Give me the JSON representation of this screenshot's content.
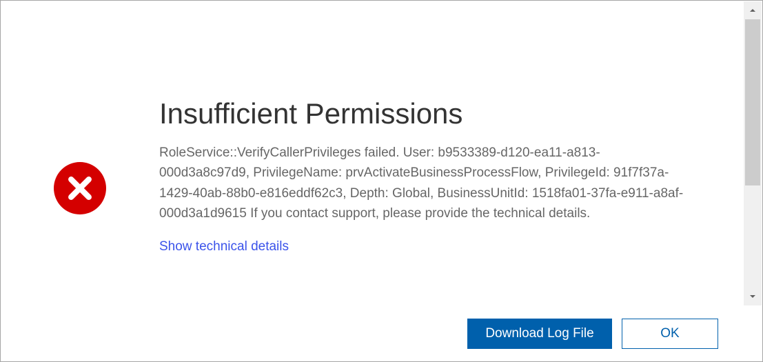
{
  "dialog": {
    "title": "Insufficient Permissions",
    "message": "RoleService::VerifyCallerPrivileges failed. User: b9533389-d120-ea11-a813-000d3a8c97d9, PrivilegeName: prvActivateBusinessProcessFlow, PrivilegeId: 91f7f37a-1429-40ab-88b0-e816eddf62c3, Depth: Global, BusinessUnitId: 1518fa01-37fa-e911-a8af-000d3a1d9615 If you contact support, please provide the technical details.",
    "technical_link": "Show technical details"
  },
  "buttons": {
    "download": "Download Log File",
    "ok": "OK"
  },
  "colors": {
    "error": "#d40000",
    "primary": "#0060ac",
    "link": "#3b53ea"
  }
}
